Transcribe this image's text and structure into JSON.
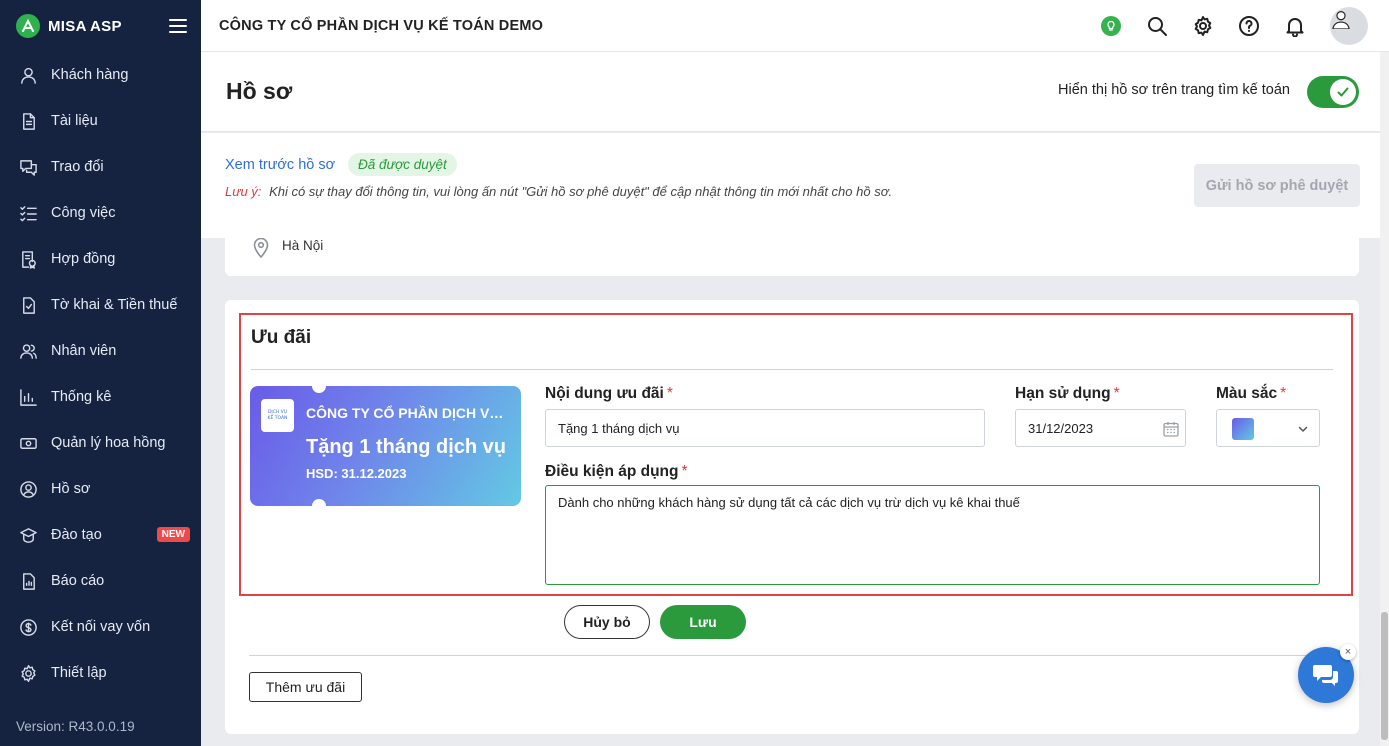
{
  "app": {
    "brand": "MISA ASP",
    "company": "CÔNG TY CỔ PHẦN DỊCH VỤ KẾ TOÁN DEMO",
    "version": "Version: R43.0.0.19"
  },
  "sidebar": {
    "items": [
      {
        "label": "Khách hàng",
        "icon": "user-icon"
      },
      {
        "label": "Tài liệu",
        "icon": "document-icon"
      },
      {
        "label": "Trao đổi",
        "icon": "chat-icon"
      },
      {
        "label": "Công việc",
        "icon": "task-list-icon"
      },
      {
        "label": "Hợp đồng",
        "icon": "contract-icon"
      },
      {
        "label": "Tờ khai & Tiền thuế",
        "icon": "tax-file-icon"
      },
      {
        "label": "Nhân viên",
        "icon": "staff-icon"
      },
      {
        "label": "Thống kê",
        "icon": "statistics-icon"
      },
      {
        "label": "Quản lý hoa hồng",
        "icon": "commission-icon"
      },
      {
        "label": "Hồ sơ",
        "icon": "profile-icon"
      },
      {
        "label": "Đào tạo",
        "icon": "training-icon",
        "badge": "NEW"
      },
      {
        "label": "Báo cáo",
        "icon": "report-icon"
      },
      {
        "label": "Kết nối vay vốn",
        "icon": "loan-icon"
      },
      {
        "label": "Thiết lập",
        "icon": "settings-icon"
      }
    ]
  },
  "page": {
    "title": "Hồ sơ",
    "toggle_label": "Hiển thị hồ sơ trên trang tìm kế toán",
    "toggle_on": true,
    "preview_link": "Xem trước hồ sơ",
    "status_badge": "Đã được duyệt",
    "note_label": "Lưu ý:",
    "note_text": "Khi có sự thay đổi thông tin, vui lòng ấn nút \"Gửi hồ sơ phê duyệt\" để cập nhật thông tin mới nhất cho hồ sơ.",
    "send_button": "Gửi hồ sơ phê duyệt",
    "address": "Hà Nội"
  },
  "offer": {
    "section_title": "Ưu đãi",
    "voucher": {
      "company": "CÔNG TY CỔ PHẦN DỊCH VỤ KẾ TOÁN DEMO",
      "gift": "Tặng 1 tháng dịch vụ",
      "expiry": "HSD: 31.12.2023"
    },
    "content_label": "Nội dung ưu đãi",
    "content_value": "Tặng 1 tháng dịch vụ",
    "expiry_label": "Hạn sử dụng",
    "expiry_value": "31/12/2023",
    "color_label": "Màu sắc",
    "condition_label": "Điều kiện áp dụng",
    "condition_value": "Dành cho những khách hàng sử dụng tất cả các dịch vụ trừ dịch vụ kê khai thuế",
    "required_mark": "*",
    "cancel_button": "Hủy bỏ",
    "save_button": "Lưu",
    "add_button": "Thêm ưu đãi"
  },
  "chat": {
    "close_glyph": "×"
  },
  "colors": {
    "sidebar": "#152240",
    "accent_green": "#2b9a3c",
    "link_blue": "#2f6fd8",
    "highlight_red": "#e04545"
  }
}
